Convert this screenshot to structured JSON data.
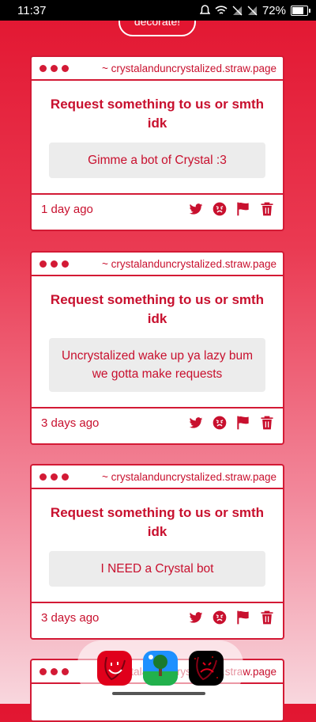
{
  "status_bar": {
    "time": "11:37",
    "battery": "72%",
    "battery_level": 0.72
  },
  "decorate_button": {
    "label": "decorate!"
  },
  "cards": [
    {
      "url": "~ crystalanduncrystalized.straw.page",
      "title": "Request something to us or smth idk",
      "message": "Gimme a bot of Crystal :3",
      "time": "1 day ago"
    },
    {
      "url": "~ crystalanduncrystalized.straw.page",
      "title": "Request something to us or smth idk",
      "message": "Uncrystalized wake up ya lazy bum we gotta make requests",
      "time": "3 days ago"
    },
    {
      "url": "~ crystalanduncrystalized.straw.page",
      "title": "Request something to us or smth idk",
      "message": "I NEED a Crystal bot",
      "time": "3 days ago"
    },
    {
      "url": "~ crystalanduncrystalized.straw.page"
    }
  ],
  "actions": [
    "twitter-icon",
    "angry-face-icon",
    "flag-icon",
    "trash-icon"
  ],
  "dock": {
    "apps": [
      "smile-app-icon",
      "landscape-app-icon",
      "dark-smile-app-icon"
    ]
  },
  "colors": {
    "accent": "#c8102e",
    "border": "#d31a35",
    "message_bg": "#ececec"
  }
}
